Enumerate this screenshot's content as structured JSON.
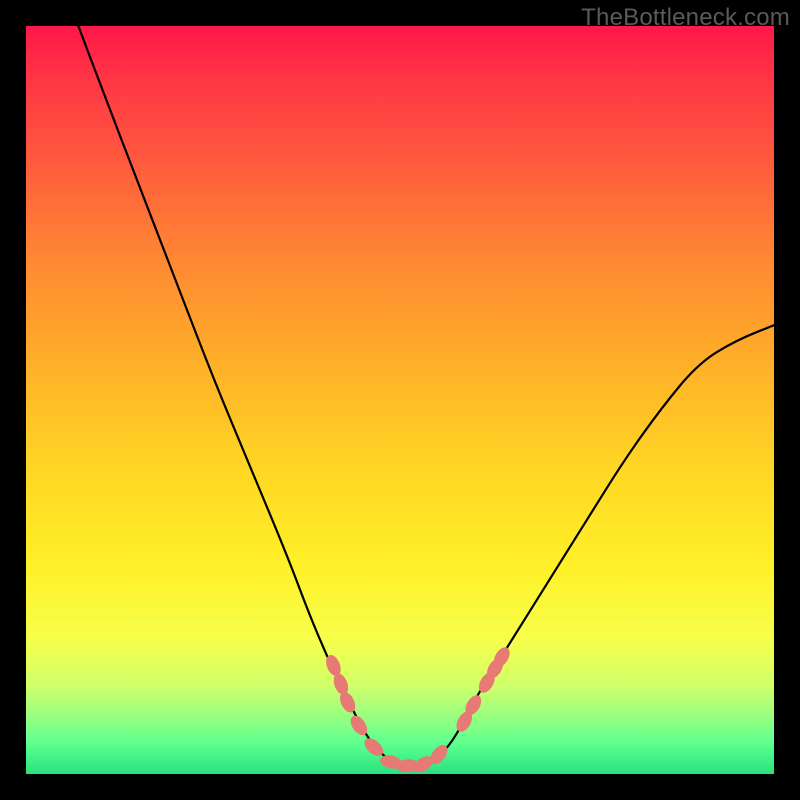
{
  "watermark": "TheBottleneck.com",
  "chart_data": {
    "type": "line",
    "title": "",
    "xlabel": "",
    "ylabel": "",
    "xlim": [
      0,
      100
    ],
    "ylim": [
      0,
      100
    ],
    "series": [
      {
        "name": "curve",
        "x": [
          7,
          10,
          15,
          20,
          25,
          30,
          35,
          38,
          41,
          43,
          45,
          47,
          50,
          53,
          56,
          58,
          60,
          65,
          70,
          75,
          80,
          85,
          90,
          95,
          100
        ],
        "y": [
          100,
          92,
          79,
          66,
          53,
          41,
          29,
          21,
          14,
          10,
          6,
          3,
          1,
          1,
          3,
          6,
          10,
          18,
          26,
          34,
          42,
          49,
          55,
          58,
          60
        ]
      }
    ],
    "markers": [
      {
        "x": 41.1,
        "y": 14.5
      },
      {
        "x": 42.1,
        "y": 12.0
      },
      {
        "x": 43.0,
        "y": 9.6
      },
      {
        "x": 44.5,
        "y": 6.5
      },
      {
        "x": 46.5,
        "y": 3.6
      },
      {
        "x": 48.8,
        "y": 1.6
      },
      {
        "x": 51.0,
        "y": 1.1
      },
      {
        "x": 53.1,
        "y": 1.3
      },
      {
        "x": 55.2,
        "y": 2.6
      },
      {
        "x": 58.6,
        "y": 7.0
      },
      {
        "x": 59.8,
        "y": 9.2
      },
      {
        "x": 61.6,
        "y": 12.2
      },
      {
        "x": 62.7,
        "y": 14.1
      },
      {
        "x": 63.6,
        "y": 15.6
      }
    ],
    "marker_color": "#e77a74",
    "curve_color": "#000000"
  }
}
